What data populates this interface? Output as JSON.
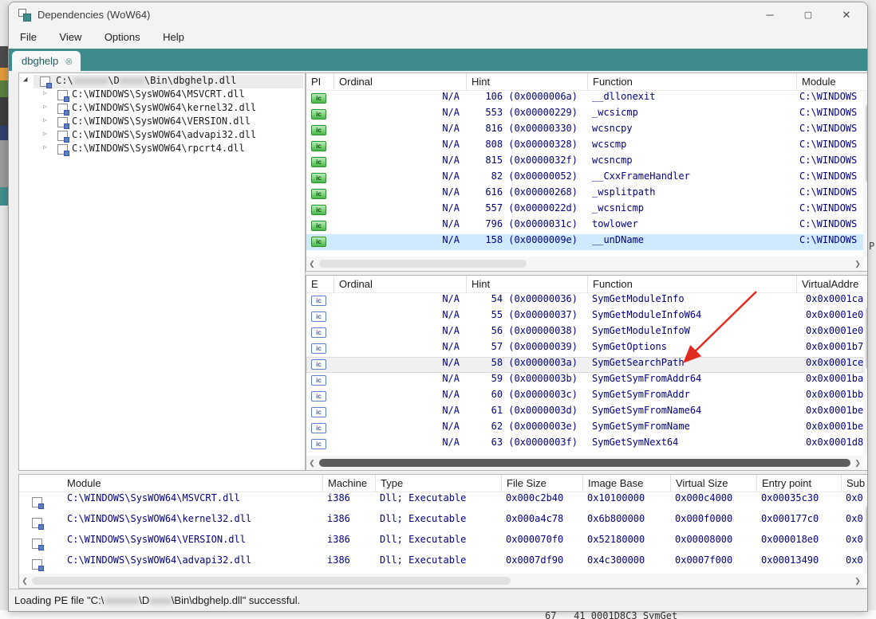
{
  "icons": {
    "minimize": "─",
    "maximize": "▢",
    "close": "✕",
    "tab_close": "⊗",
    "tree_expanded": "◢",
    "tree_collapsed": "▷",
    "import_badge": "ic",
    "export_badge": "ic",
    "chevron_left": "❮",
    "chevron_right": "❯",
    "chevron_up": "⌃",
    "chevron_down": "⌄"
  },
  "colors": {
    "accent_teal": "#3d8b8b",
    "selection_blue": "#cfe9ff",
    "selection_gray": "#f0f0f0",
    "table_text": "#000080",
    "import_green": "#49b849",
    "export_blue": "#5b7fc0",
    "arrow_red": "#e02b20"
  },
  "window": {
    "title": "Dependencies (WoW64)",
    "menu": [
      "File",
      "View",
      "Options",
      "Help"
    ],
    "tab": {
      "label": "dbghelp"
    }
  },
  "tree": {
    "root": {
      "p1": "C:\\",
      "censored1": "xxxxxxx",
      "p2": "\\D",
      "censored2": "xxxxx",
      "p3": "\\Bin\\dbghelp.dll"
    },
    "children": [
      "C:\\WINDOWS\\SysWOW64\\MSVCRT.dll",
      "C:\\WINDOWS\\SysWOW64\\kernel32.dll",
      "C:\\WINDOWS\\SysWOW64\\VERSION.dll",
      "C:\\WINDOWS\\SysWOW64\\advapi32.dll",
      "C:\\WINDOWS\\SysWOW64\\rpcrt4.dll"
    ]
  },
  "imports": {
    "columns": [
      "PI",
      "Ordinal",
      "Hint",
      "Function",
      "Module"
    ],
    "selected_row": 9,
    "rows": [
      {
        "ordinal": "N/A",
        "hint": "106 (0x0000006a)",
        "function": "__dllonexit",
        "module": "C:\\WINDOWS"
      },
      {
        "ordinal": "N/A",
        "hint": "553 (0x00000229)",
        "function": "_wcsicmp",
        "module": "C:\\WINDOWS"
      },
      {
        "ordinal": "N/A",
        "hint": "816 (0x00000330)",
        "function": "wcsncpy",
        "module": "C:\\WINDOWS"
      },
      {
        "ordinal": "N/A",
        "hint": "808 (0x00000328)",
        "function": "wcscmp",
        "module": "C:\\WINDOWS"
      },
      {
        "ordinal": "N/A",
        "hint": "815 (0x0000032f)",
        "function": "wcsncmp",
        "module": "C:\\WINDOWS"
      },
      {
        "ordinal": "N/A",
        "hint": "82 (0x00000052)",
        "function": "__CxxFrameHandler",
        "module": "C:\\WINDOWS"
      },
      {
        "ordinal": "N/A",
        "hint": "616 (0x00000268)",
        "function": "_wsplitpath",
        "module": "C:\\WINDOWS"
      },
      {
        "ordinal": "N/A",
        "hint": "557 (0x0000022d)",
        "function": "_wcsnicmp",
        "module": "C:\\WINDOWS"
      },
      {
        "ordinal": "N/A",
        "hint": "796 (0x0000031c)",
        "function": "towlower",
        "module": "C:\\WINDOWS"
      },
      {
        "ordinal": "N/A",
        "hint": "158 (0x0000009e)",
        "function": "__unDName",
        "module": "C:\\WINDOWS"
      }
    ]
  },
  "exports": {
    "columns": [
      "E",
      "Ordinal",
      "Hint",
      "Function",
      "VirtualAddre"
    ],
    "selected_row": 4,
    "rows": [
      {
        "ordinal": "N/A",
        "hint": "54 (0x00000036)",
        "function": "SymGetModuleInfo",
        "virtual_address": "0x0x0001ca"
      },
      {
        "ordinal": "N/A",
        "hint": "55 (0x00000037)",
        "function": "SymGetModuleInfoW64",
        "virtual_address": "0x0x0001e0"
      },
      {
        "ordinal": "N/A",
        "hint": "56 (0x00000038)",
        "function": "SymGetModuleInfoW",
        "virtual_address": "0x0x0001e0"
      },
      {
        "ordinal": "N/A",
        "hint": "57 (0x00000039)",
        "function": "SymGetOptions",
        "virtual_address": "0x0x0001b7"
      },
      {
        "ordinal": "N/A",
        "hint": "58 (0x0000003a)",
        "function": "SymGetSearchPath",
        "virtual_address": "0x0x0001ce"
      },
      {
        "ordinal": "N/A",
        "hint": "59 (0x0000003b)",
        "function": "SymGetSymFromAddr64",
        "virtual_address": "0x0x0001ba"
      },
      {
        "ordinal": "N/A",
        "hint": "60 (0x0000003c)",
        "function": "SymGetSymFromAddr",
        "virtual_address": "0x0x0001bb"
      },
      {
        "ordinal": "N/A",
        "hint": "61 (0x0000003d)",
        "function": "SymGetSymFromName64",
        "virtual_address": "0x0x0001be"
      },
      {
        "ordinal": "N/A",
        "hint": "62 (0x0000003e)",
        "function": "SymGetSymFromName",
        "virtual_address": "0x0x0001be"
      },
      {
        "ordinal": "N/A",
        "hint": "63 (0x0000003f)",
        "function": "SymGetSymNext64",
        "virtual_address": "0x0x0001d8"
      }
    ]
  },
  "modules": {
    "columns": [
      "Module",
      "Machine",
      "Type",
      "File Size",
      "Image Base",
      "Virtual Size",
      "Entry point",
      "Sub"
    ],
    "rows": [
      {
        "module": "C:\\WINDOWS\\SysWOW64\\MSVCRT.dll",
        "machine": "i386",
        "type": "Dll; Executable",
        "file_size": "0x000c2b40",
        "image_base": "0x10100000",
        "virtual_size": "0x000c4000",
        "entry_point": "0x00035c30",
        "sub": "0x0"
      },
      {
        "module": "C:\\WINDOWS\\SysWOW64\\kernel32.dll",
        "machine": "i386",
        "type": "Dll; Executable",
        "file_size": "0x000a4c78",
        "image_base": "0x6b800000",
        "virtual_size": "0x000f0000",
        "entry_point": "0x000177c0",
        "sub": "0x0"
      },
      {
        "module": "C:\\WINDOWS\\SysWOW64\\VERSION.dll",
        "machine": "i386",
        "type": "Dll; Executable",
        "file_size": "0x000070f0",
        "image_base": "0x52180000",
        "virtual_size": "0x00008000",
        "entry_point": "0x000018e0",
        "sub": "0x0"
      },
      {
        "module": "C:\\WINDOWS\\SysWOW64\\advapi32.dll",
        "machine": "i386",
        "type": "Dll; Executable",
        "file_size": "0x0007df90",
        "image_base": "0x4c300000",
        "virtual_size": "0x0007f000",
        "entry_point": "0x00013490",
        "sub": "0x0"
      }
    ]
  },
  "status": {
    "p1": "Loading PE file \"C:\\",
    "censored1": "xxxxxxxx",
    "p2": "\\D",
    "censored2": "xxxxx",
    "p3": "\\Bin\\dbghelp.dll\" successful."
  },
  "background": {
    "bottom_text": "67   41 0001D8C3 SymGet",
    "right_text": "P"
  }
}
